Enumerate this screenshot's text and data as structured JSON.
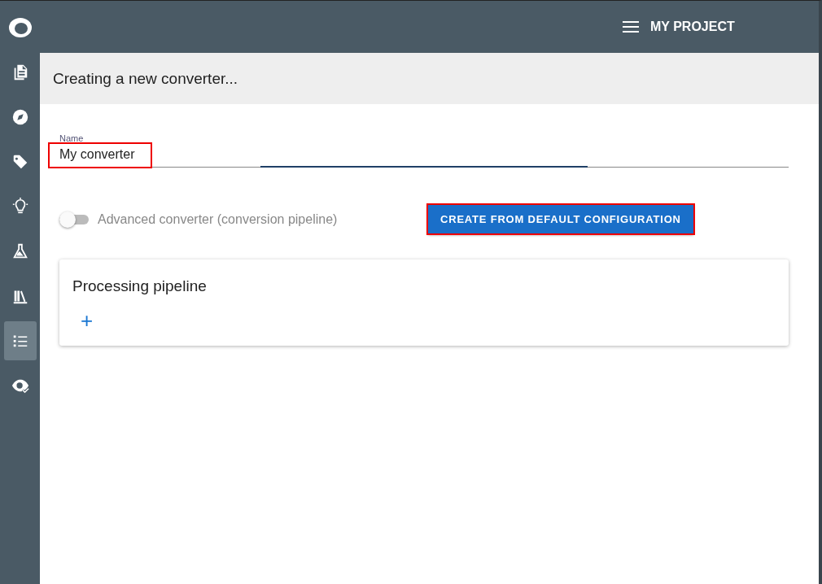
{
  "sidebar": {
    "items": [
      {
        "kind": "document",
        "selected": false
      },
      {
        "kind": "compass",
        "selected": false
      },
      {
        "kind": "tag",
        "selected": false
      },
      {
        "kind": "bulb",
        "selected": false
      },
      {
        "kind": "flask",
        "selected": false
      },
      {
        "kind": "books",
        "selected": false
      },
      {
        "kind": "list",
        "selected": true
      },
      {
        "kind": "eye",
        "selected": false
      }
    ]
  },
  "top_bar": {
    "project": "MY PROJECT"
  },
  "page_title": "Creating a new converter...",
  "name_field": {
    "label": "Name",
    "value": "My converter",
    "highlighted": true
  },
  "advanced_toggle": {
    "label": "Advanced converter (conversion pipeline)",
    "on": false
  },
  "default_button": {
    "label": "CREATE FROM DEFAULT CONFIGURATION",
    "highlighted": true
  },
  "pipeline_card": {
    "title": "Processing pipeline",
    "add": "+"
  }
}
